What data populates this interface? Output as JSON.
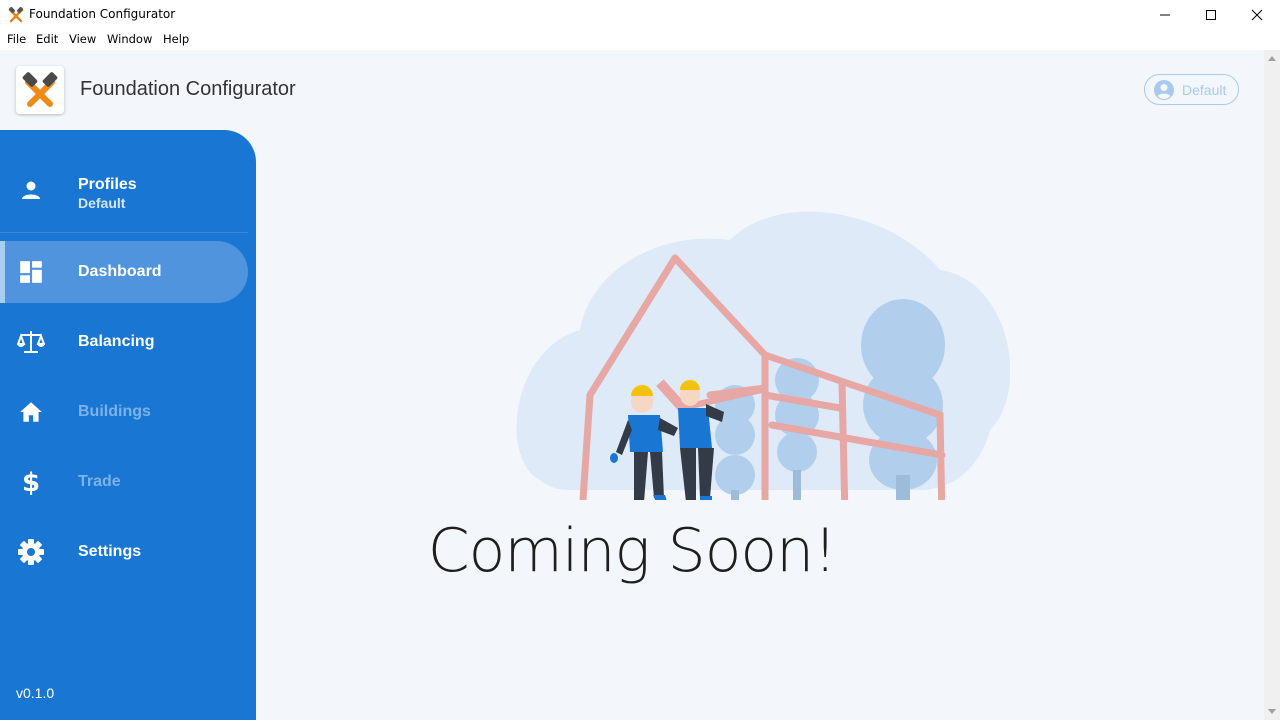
{
  "window": {
    "title": "Foundation Configurator",
    "controls": [
      "minimize",
      "maximize",
      "close"
    ]
  },
  "menu": [
    "File",
    "Edit",
    "View",
    "Window",
    "Help"
  ],
  "header": {
    "app_name": "Foundation Configurator",
    "profile_chip": "Default"
  },
  "sidebar": {
    "profiles": {
      "title": "Profiles",
      "subtitle": "Default"
    },
    "items": [
      {
        "label": "Dashboard",
        "icon": "dashboard-icon",
        "state": "active"
      },
      {
        "label": "Balancing",
        "icon": "scale-icon",
        "state": "enabled"
      },
      {
        "label": "Buildings",
        "icon": "home-icon",
        "state": "disabled"
      },
      {
        "label": "Trade",
        "icon": "dollar-icon",
        "state": "disabled"
      },
      {
        "label": "Settings",
        "icon": "gear-icon",
        "state": "enabled"
      }
    ],
    "version": "v0.1.0"
  },
  "main": {
    "message": "Coming Soon!"
  },
  "colors": {
    "sidebar": "#1976d2",
    "active_item": "#4f94dd",
    "background": "#f3f7fb",
    "disabled_text": "#7cb2ea"
  }
}
